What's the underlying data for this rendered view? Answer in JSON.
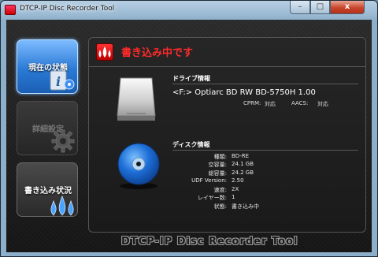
{
  "window": {
    "title": "DTCP-IP Disc Recorder Tool",
    "min_glyph": "–",
    "max_glyph": "□",
    "close_glyph": "x"
  },
  "nav": {
    "items": [
      {
        "label": "現在の状態",
        "state": "selected",
        "icon": "info-icon"
      },
      {
        "label": "詳細設定",
        "state": "disabled",
        "icon": "gear-icon"
      },
      {
        "label": "書き込み状況",
        "state": "normal",
        "icon": "flame-icon"
      }
    ]
  },
  "status": {
    "title": "書き込み中です",
    "color": "#ff2a2a",
    "icon": "flame-icon"
  },
  "drive": {
    "section_title": "ドライブ情報",
    "name": "<F:> Optiarc BD RW BD-5750H 1.00",
    "cprm_label": "CPRM:",
    "cprm_value": "対応",
    "aacs_label": "AACS:",
    "aacs_value": "対応",
    "icon": "hard-drive-icon"
  },
  "disc": {
    "section_title": "ディスク情報",
    "icon": "disc-icon",
    "rows": [
      {
        "label": "種類:",
        "value": "BD-RE"
      },
      {
        "label": "空容量:",
        "value": "24.1 GB"
      },
      {
        "label": "総容量:",
        "value": "24.2 GB"
      },
      {
        "label": "UDF Version:",
        "value": "2.50"
      },
      {
        "label": "速度:",
        "value": "2X"
      },
      {
        "label": "レイヤー数:",
        "value": "1"
      },
      {
        "label": "状態:",
        "value": "書き込み中"
      }
    ]
  },
  "footer": {
    "brand": "DTCP-IP Disc Recorder Tool"
  }
}
